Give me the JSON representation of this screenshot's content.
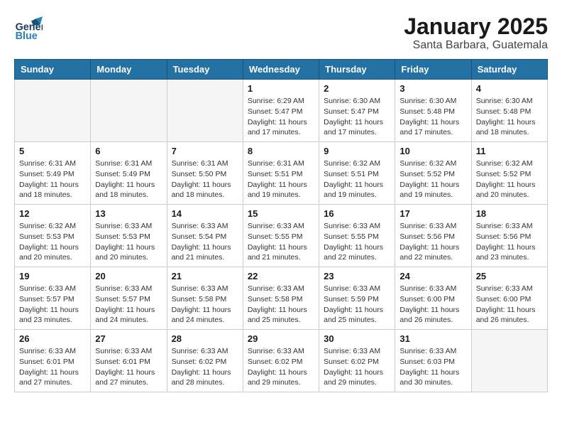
{
  "header": {
    "logo_line1": "General",
    "logo_line2": "Blue",
    "title": "January 2025",
    "subtitle": "Santa Barbara, Guatemala"
  },
  "calendar": {
    "days_of_week": [
      "Sunday",
      "Monday",
      "Tuesday",
      "Wednesday",
      "Thursday",
      "Friday",
      "Saturday"
    ],
    "weeks": [
      {
        "days": [
          {
            "num": "",
            "info": ""
          },
          {
            "num": "",
            "info": ""
          },
          {
            "num": "",
            "info": ""
          },
          {
            "num": "1",
            "info": "Sunrise: 6:29 AM\nSunset: 5:47 PM\nDaylight: 11 hours\nand 17 minutes."
          },
          {
            "num": "2",
            "info": "Sunrise: 6:30 AM\nSunset: 5:47 PM\nDaylight: 11 hours\nand 17 minutes."
          },
          {
            "num": "3",
            "info": "Sunrise: 6:30 AM\nSunset: 5:48 PM\nDaylight: 11 hours\nand 17 minutes."
          },
          {
            "num": "4",
            "info": "Sunrise: 6:30 AM\nSunset: 5:48 PM\nDaylight: 11 hours\nand 18 minutes."
          }
        ]
      },
      {
        "days": [
          {
            "num": "5",
            "info": "Sunrise: 6:31 AM\nSunset: 5:49 PM\nDaylight: 11 hours\nand 18 minutes."
          },
          {
            "num": "6",
            "info": "Sunrise: 6:31 AM\nSunset: 5:49 PM\nDaylight: 11 hours\nand 18 minutes."
          },
          {
            "num": "7",
            "info": "Sunrise: 6:31 AM\nSunset: 5:50 PM\nDaylight: 11 hours\nand 18 minutes."
          },
          {
            "num": "8",
            "info": "Sunrise: 6:31 AM\nSunset: 5:51 PM\nDaylight: 11 hours\nand 19 minutes."
          },
          {
            "num": "9",
            "info": "Sunrise: 6:32 AM\nSunset: 5:51 PM\nDaylight: 11 hours\nand 19 minutes."
          },
          {
            "num": "10",
            "info": "Sunrise: 6:32 AM\nSunset: 5:52 PM\nDaylight: 11 hours\nand 19 minutes."
          },
          {
            "num": "11",
            "info": "Sunrise: 6:32 AM\nSunset: 5:52 PM\nDaylight: 11 hours\nand 20 minutes."
          }
        ]
      },
      {
        "days": [
          {
            "num": "12",
            "info": "Sunrise: 6:32 AM\nSunset: 5:53 PM\nDaylight: 11 hours\nand 20 minutes."
          },
          {
            "num": "13",
            "info": "Sunrise: 6:33 AM\nSunset: 5:53 PM\nDaylight: 11 hours\nand 20 minutes."
          },
          {
            "num": "14",
            "info": "Sunrise: 6:33 AM\nSunset: 5:54 PM\nDaylight: 11 hours\nand 21 minutes."
          },
          {
            "num": "15",
            "info": "Sunrise: 6:33 AM\nSunset: 5:55 PM\nDaylight: 11 hours\nand 21 minutes."
          },
          {
            "num": "16",
            "info": "Sunrise: 6:33 AM\nSunset: 5:55 PM\nDaylight: 11 hours\nand 22 minutes."
          },
          {
            "num": "17",
            "info": "Sunrise: 6:33 AM\nSunset: 5:56 PM\nDaylight: 11 hours\nand 22 minutes."
          },
          {
            "num": "18",
            "info": "Sunrise: 6:33 AM\nSunset: 5:56 PM\nDaylight: 11 hours\nand 23 minutes."
          }
        ]
      },
      {
        "days": [
          {
            "num": "19",
            "info": "Sunrise: 6:33 AM\nSunset: 5:57 PM\nDaylight: 11 hours\nand 23 minutes."
          },
          {
            "num": "20",
            "info": "Sunrise: 6:33 AM\nSunset: 5:57 PM\nDaylight: 11 hours\nand 24 minutes."
          },
          {
            "num": "21",
            "info": "Sunrise: 6:33 AM\nSunset: 5:58 PM\nDaylight: 11 hours\nand 24 minutes."
          },
          {
            "num": "22",
            "info": "Sunrise: 6:33 AM\nSunset: 5:58 PM\nDaylight: 11 hours\nand 25 minutes."
          },
          {
            "num": "23",
            "info": "Sunrise: 6:33 AM\nSunset: 5:59 PM\nDaylight: 11 hours\nand 25 minutes."
          },
          {
            "num": "24",
            "info": "Sunrise: 6:33 AM\nSunset: 6:00 PM\nDaylight: 11 hours\nand 26 minutes."
          },
          {
            "num": "25",
            "info": "Sunrise: 6:33 AM\nSunset: 6:00 PM\nDaylight: 11 hours\nand 26 minutes."
          }
        ]
      },
      {
        "days": [
          {
            "num": "26",
            "info": "Sunrise: 6:33 AM\nSunset: 6:01 PM\nDaylight: 11 hours\nand 27 minutes."
          },
          {
            "num": "27",
            "info": "Sunrise: 6:33 AM\nSunset: 6:01 PM\nDaylight: 11 hours\nand 27 minutes."
          },
          {
            "num": "28",
            "info": "Sunrise: 6:33 AM\nSunset: 6:02 PM\nDaylight: 11 hours\nand 28 minutes."
          },
          {
            "num": "29",
            "info": "Sunrise: 6:33 AM\nSunset: 6:02 PM\nDaylight: 11 hours\nand 29 minutes."
          },
          {
            "num": "30",
            "info": "Sunrise: 6:33 AM\nSunset: 6:02 PM\nDaylight: 11 hours\nand 29 minutes."
          },
          {
            "num": "31",
            "info": "Sunrise: 6:33 AM\nSunset: 6:03 PM\nDaylight: 11 hours\nand 30 minutes."
          },
          {
            "num": "",
            "info": ""
          }
        ]
      }
    ]
  }
}
